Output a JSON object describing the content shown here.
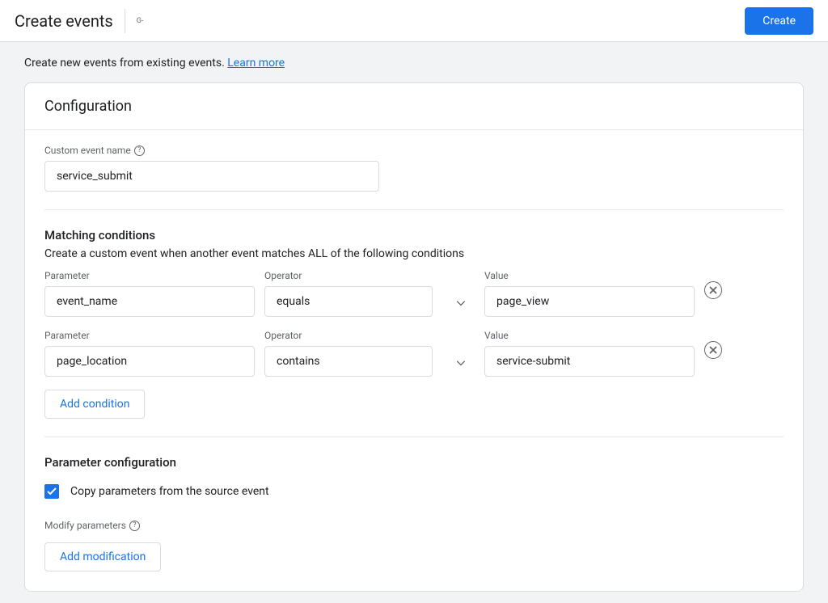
{
  "header": {
    "title": "Create events",
    "subtitle": "G-",
    "create_btn": "Create"
  },
  "info": {
    "text": "Create new events from existing events. ",
    "learn_more": "Learn more"
  },
  "card": {
    "title": "Configuration"
  },
  "custom_event": {
    "label": "Custom event name",
    "value": "service_submit"
  },
  "matching": {
    "heading": "Matching conditions",
    "sub": "Create a custom event when another event matches ALL of the following conditions",
    "labels": {
      "param": "Parameter",
      "op": "Operator",
      "val": "Value"
    },
    "rows": [
      {
        "param": "event_name",
        "op": "equals",
        "val": "page_view"
      },
      {
        "param": "page_location",
        "op": "contains",
        "val": "service-submit"
      }
    ],
    "add_btn": "Add condition"
  },
  "param_config": {
    "heading": "Parameter configuration",
    "copy_label": "Copy parameters from the source event",
    "modify_label": "Modify parameters",
    "add_btn": "Add modification"
  }
}
